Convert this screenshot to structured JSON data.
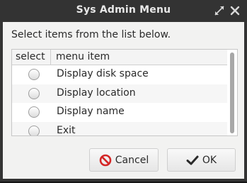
{
  "window": {
    "title": "Sys Admin Menu",
    "icons": {
      "maximize": "maximize-arrows-icon",
      "close": "close-icon"
    }
  },
  "dialog": {
    "instruction": "Select items from the list below.",
    "columns": {
      "select": "select",
      "item": "menu item"
    },
    "items": [
      {
        "label": "Display disk space",
        "selected": false
      },
      {
        "label": "Display location",
        "selected": false
      },
      {
        "label": "Display name",
        "selected": false
      },
      {
        "label": "Exit",
        "selected": false
      }
    ]
  },
  "buttons": {
    "cancel": {
      "label": "Cancel",
      "icon": "cancel-icon"
    },
    "ok": {
      "label": "OK",
      "icon": "checkmark-icon"
    }
  },
  "colors": {
    "titlebar": "#333333",
    "dialog_bg": "#f2f2f1",
    "cancel_icon": "#d42626",
    "desktop_accent": "#21b32b"
  }
}
